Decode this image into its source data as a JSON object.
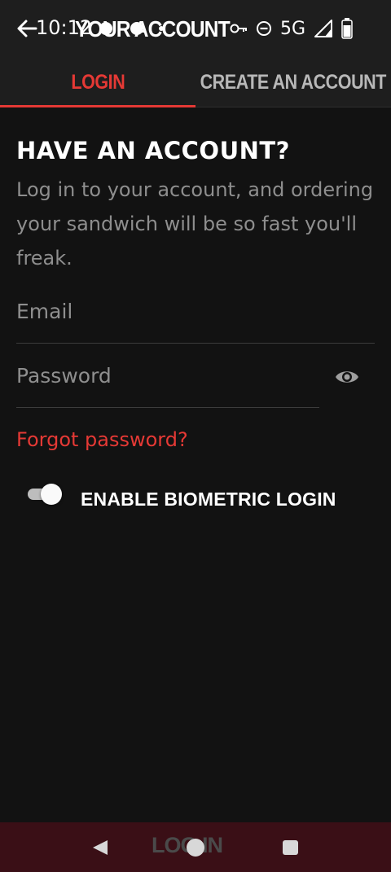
{
  "status_bar": {
    "time": "10:12",
    "network": "5G",
    "icons": [
      "vpn-key-icon",
      "do-not-disturb-icon",
      "signal-icon",
      "battery-icon"
    ]
  },
  "app_bar": {
    "title": "YOUR ACCOUNT",
    "back_icon": "back-arrow-icon"
  },
  "tabs": [
    {
      "label": "LOGIN",
      "selected": true
    },
    {
      "label": "CREATE AN ACCOUNT",
      "selected": false
    }
  ],
  "login": {
    "heading": "HAVE AN ACCOUNT?",
    "subtext": "Log in to your account, and ordering your sandwich will be so fast you'll freak.",
    "email_placeholder": "Email",
    "password_placeholder": "Password",
    "forgot_label": "Forgot password?",
    "biometric_label": "ENABLE BIOMETRIC LOGIN",
    "biometric_enabled": true
  },
  "bottom_bar": {
    "login_label": "LOG IN"
  },
  "colors": {
    "accent": "#e53935",
    "background": "#121212",
    "bar": "#1e1e1e",
    "bottom_bar": "#3a0f16"
  }
}
